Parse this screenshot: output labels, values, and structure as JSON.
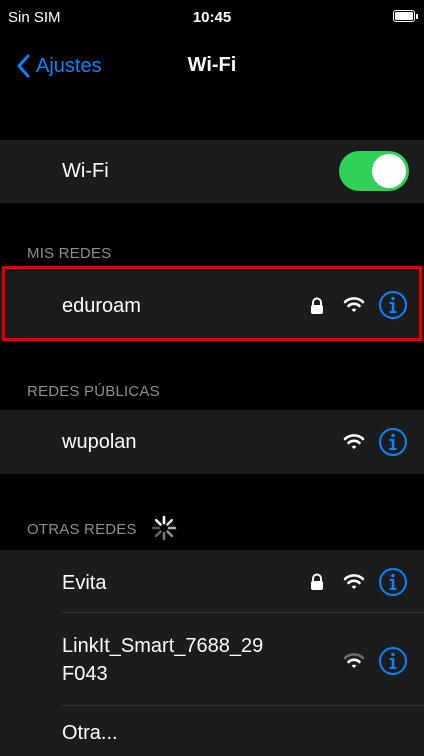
{
  "status": {
    "carrier": "Sin SIM",
    "time": "10:45"
  },
  "nav": {
    "back_label": "Ajustes",
    "title": "Wi-Fi"
  },
  "wifi": {
    "label": "Wi-Fi",
    "enabled": true
  },
  "sections": {
    "my_networks": "MIS REDES",
    "public_networks": "REDES PÚBLICAS",
    "other_networks": "OTRAS REDES"
  },
  "networks": {
    "eduroam": {
      "name": "eduroam",
      "secured": true,
      "signal": "strong"
    },
    "wupolan": {
      "name": "wupolan",
      "secured": false,
      "signal": "strong"
    },
    "evita": {
      "name": "Evita",
      "secured": true,
      "signal": "strong"
    },
    "linkit": {
      "name_line1": "LinkIt_Smart_7688_29",
      "name_line2": "F043",
      "secured": false,
      "signal": "weak"
    },
    "other": {
      "name": "Otra..."
    }
  },
  "colors": {
    "accent": "#0a84ff",
    "toggle_on": "#30d158",
    "highlight": "#e10000"
  },
  "icons": [
    "chevron-left-icon",
    "lock-icon",
    "wifi-icon",
    "info-icon",
    "spinner-icon"
  ]
}
